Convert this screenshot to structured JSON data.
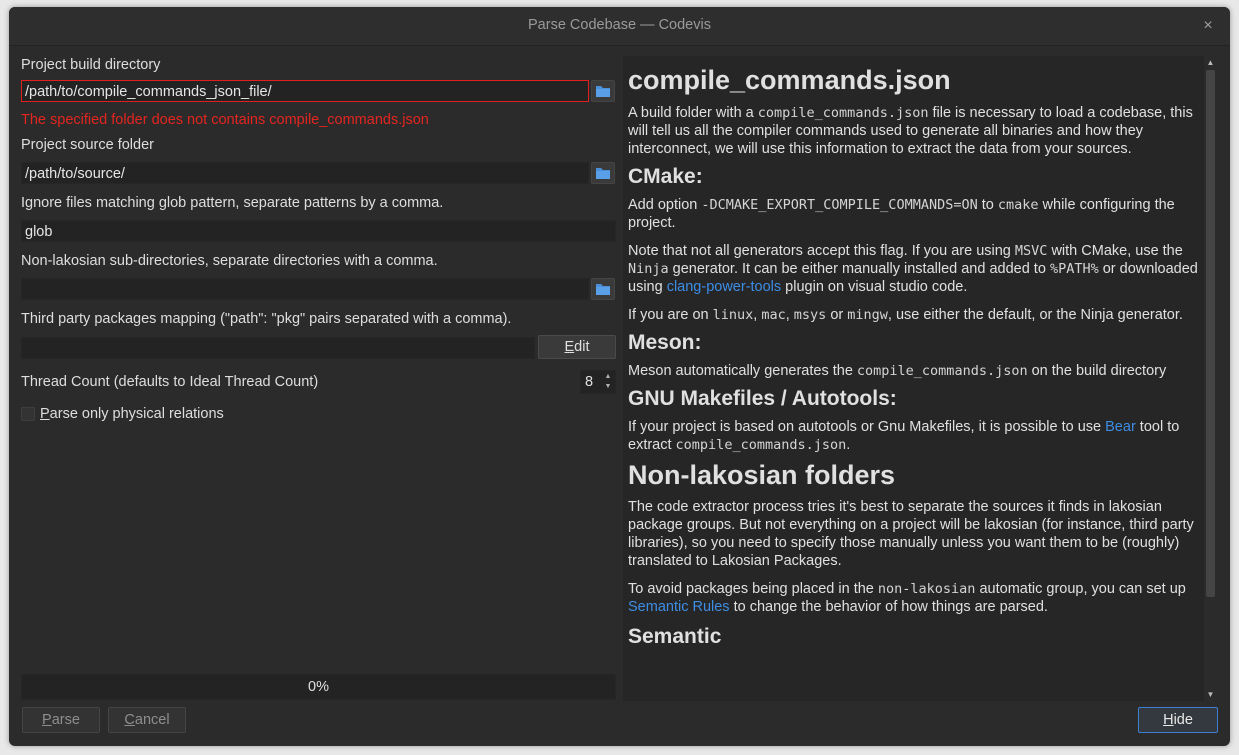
{
  "window": {
    "title": "Parse Codebase — Codevis",
    "close_icon": "×"
  },
  "form": {
    "build_dir_label": "Project build directory",
    "build_dir_value": "/path/to/compile_commands_json_file/",
    "build_dir_error": "The specified folder does not contains compile_commands.json",
    "source_label": "Project source folder",
    "source_value": "/path/to/source/",
    "ignore_label": "Ignore files matching glob pattern, separate patterns by a comma.",
    "ignore_value": "glob",
    "nonlakos_label": "Non-lakosian sub-directories, separate directories with a comma.",
    "nonlakos_value": "",
    "thirdparty_label": "Third party packages mapping (\"path\": \"pkg\" pairs separated with a comma).",
    "thirdparty_value": "",
    "edit_label_rest": "dit",
    "edit_label_mnemonic": "E",
    "thread_label": "Thread Count (defaults to Ideal Thread Count)",
    "thread_value": "8",
    "physical_label_mnemonic": "P",
    "physical_label_rest": "arse only physical relations",
    "physical_checked": false
  },
  "progress": {
    "text": "0%",
    "value": 0
  },
  "buttons": {
    "parse_mnemonic": "P",
    "parse_rest": "arse",
    "cancel_mnemonic": "C",
    "cancel_rest": "ancel",
    "hide_mnemonic": "H",
    "hide_rest": "ide"
  },
  "colors": {
    "error": "#e3251f",
    "link": "#3d8de5",
    "accent": "#3d7fd0",
    "folder_icon": "#4a8fd8"
  },
  "help": {
    "h_compile": "compile_commands.json",
    "p1_a": "A build folder with a ",
    "p1_code": "compile_commands.json",
    "p1_b": " file is necessary to load a codebase, this will tell us all the compiler commands used to generate all binaries and how they interconnect, we will use this information to extract the data from your sources.",
    "h_cmake": "CMake:",
    "p2_a": "Add option ",
    "p2_code1": "-DCMAKE_EXPORT_COMPILE_COMMANDS=ON",
    "p2_b": " to ",
    "p2_code2": "cmake",
    "p2_c": " while configuring the project.",
    "p3_a": "Note that not all generators accept this flag. If you are using ",
    "p3_code1": "MSVC",
    "p3_b": " with CMake, use the ",
    "p3_code2": "Ninja",
    "p3_c": " generator. It can be either manually installed and added to ",
    "p3_code3": "%PATH%",
    "p3_d": " or downloaded using ",
    "p3_link": "clang-power-tools",
    "p3_e": " plugin on visual studio code.",
    "p4_a": "If you are on ",
    "p4_code1": "linux",
    "p4_code2": "mac",
    "p4_code3": "msys",
    "p4_b": " or ",
    "p4_code4": "mingw",
    "p4_c": ", use either the default, or the Ninja generator.",
    "comma": ", ",
    "h_meson": "Meson:",
    "p5_a": "Meson automatically generates the ",
    "p5_code": "compile_commands.json",
    "p5_b": " on the build directory",
    "h_gnu": "GNU Makefiles / Autotools:",
    "p6_a": "If your project is based on autotools or Gnu Makefiles, it is possible to use ",
    "p6_link": "Bear",
    "p6_b": " tool to extract ",
    "p6_code": "compile_commands.json",
    "p6_c": ".",
    "h_nonlakos": "Non-lakosian folders",
    "p7": "The code extractor process tries it's best to separate the sources it finds in lakosian package groups. But not everything on a project will be lakosian (for instance, third party libraries), so you need to specify those manually unless you want them to be (roughly) translated to Lakosian Packages.",
    "p8_a": "To avoid packages being placed in the ",
    "p8_code": "non-lakosian",
    "p8_b": " automatic group, you can set up ",
    "p8_link": "Semantic Rules",
    "p8_c": " to change the behavior of how things are parsed.",
    "h_cut": "Semantic"
  }
}
